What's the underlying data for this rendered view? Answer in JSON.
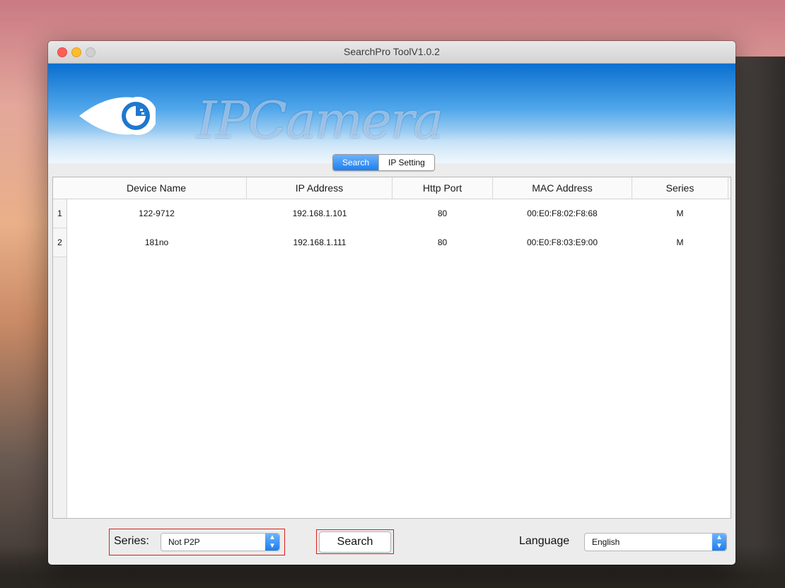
{
  "window": {
    "title": "SearchPro ToolV1.0.2"
  },
  "banner": {
    "brand": "IPCamera"
  },
  "tabs": [
    {
      "label": "Search",
      "active": true
    },
    {
      "label": "IP Setting",
      "active": false
    }
  ],
  "table": {
    "headers": [
      "Device Name",
      "IP Address",
      "Http Port",
      "MAC Address",
      "Series"
    ],
    "rows": [
      {
        "num": "1",
        "device_name": "122-9712",
        "ip": "192.168.1.101",
        "port": "80",
        "mac": "00:E0:F8:02:F8:68",
        "series": "M"
      },
      {
        "num": "2",
        "device_name": "181no",
        "ip": "192.168.1.111",
        "port": "80",
        "mac": "00:E0:F8:03:E9:00",
        "series": "M"
      }
    ]
  },
  "footer": {
    "series_label": "Series:",
    "series_value": "Not P2P",
    "search_button": "Search",
    "language_label": "Language",
    "language_value": "English"
  },
  "colors": {
    "accent": "#1d7ff0",
    "highlight_box": "#d9201b",
    "banner_top": "#0b6fd0"
  }
}
